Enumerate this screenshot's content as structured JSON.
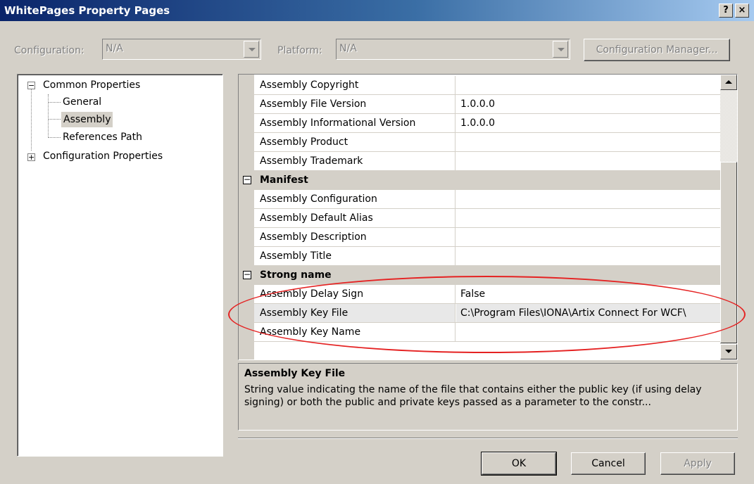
{
  "window": {
    "title": "WhitePages Property Pages",
    "help_button": "?",
    "close_button": "×"
  },
  "toolbar": {
    "configuration_label": "Configuration:",
    "configuration_value": "N/A",
    "platform_label": "Platform:",
    "platform_value": "N/A",
    "config_manager_button": "Configuration Manager..."
  },
  "tree": {
    "common_properties": "Common Properties",
    "general": "General",
    "assembly": "Assembly",
    "references_path": "References Path",
    "configuration_properties": "Configuration Properties",
    "expanded_glyph": "−",
    "collapsed_glyph": "+"
  },
  "grid": {
    "collapse_glyph": "−",
    "top_rows": [
      {
        "name": "Assembly Copyright",
        "value": ""
      },
      {
        "name": "Assembly File Version",
        "value": "1.0.0.0"
      },
      {
        "name": "Assembly Informational Version",
        "value": "1.0.0.0"
      },
      {
        "name": "Assembly Product",
        "value": ""
      },
      {
        "name": "Assembly Trademark",
        "value": ""
      }
    ],
    "manifest_category": "Manifest",
    "manifest_rows": [
      {
        "name": "Assembly Configuration",
        "value": ""
      },
      {
        "name": "Assembly Default Alias",
        "value": ""
      },
      {
        "name": "Assembly Description",
        "value": ""
      },
      {
        "name": "Assembly Title",
        "value": ""
      }
    ],
    "strong_name_category": "Strong name",
    "strong_name_rows": [
      {
        "name": "Assembly Delay Sign",
        "value": "False"
      },
      {
        "name": "Assembly Key File",
        "value": "C:\\Program Files\\IONA\\Artix Connect For WCF\\"
      },
      {
        "name": "Assembly Key Name",
        "value": ""
      }
    ],
    "selected_row": "Assembly Key File"
  },
  "description": {
    "title": "Assembly Key File",
    "text": "String value indicating the name of the file that contains either the public key (if using delay signing) or both the public and private keys passed as a parameter to the constr..."
  },
  "buttons": {
    "ok": "OK",
    "cancel": "Cancel",
    "apply": "Apply"
  },
  "colors": {
    "dialog_bg": "#d4d0c8",
    "title_gradient_start": "#0a246a",
    "title_gradient_end": "#a6caf0",
    "annotation_ellipse": "#e52222"
  }
}
